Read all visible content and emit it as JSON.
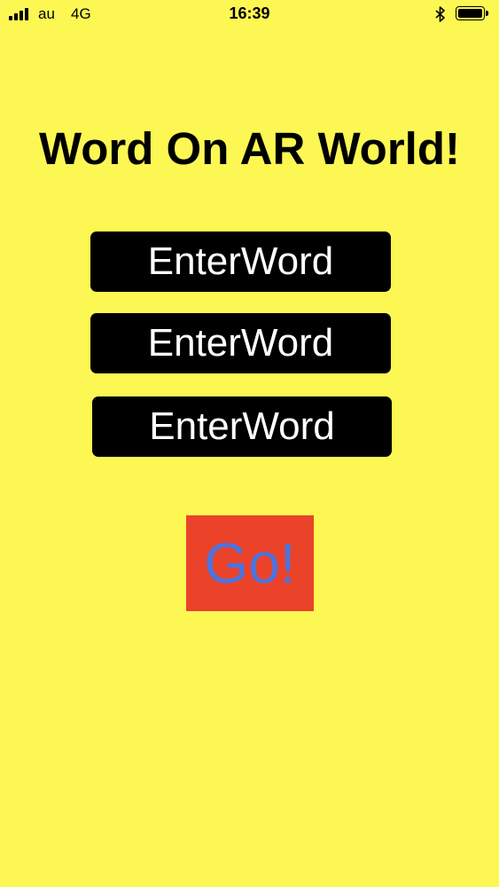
{
  "status_bar": {
    "carrier": "au",
    "network": "4G",
    "time": "16:39",
    "signal_icon": "cellular-signal-icon",
    "bluetooth_icon": "bluetooth-icon",
    "battery_icon": "battery-icon"
  },
  "title": "Word On AR World!",
  "fields": [
    {
      "placeholder": "EnterWord",
      "value": ""
    },
    {
      "placeholder": "EnterWord",
      "value": ""
    },
    {
      "placeholder": "EnterWord",
      "value": ""
    }
  ],
  "go_button": {
    "label": "Go!"
  },
  "colors": {
    "background": "#FDF754",
    "field_background": "#000000",
    "field_text": "#FFFFFF",
    "button_background": "#EA432A",
    "button_text": "#4C73E0"
  }
}
